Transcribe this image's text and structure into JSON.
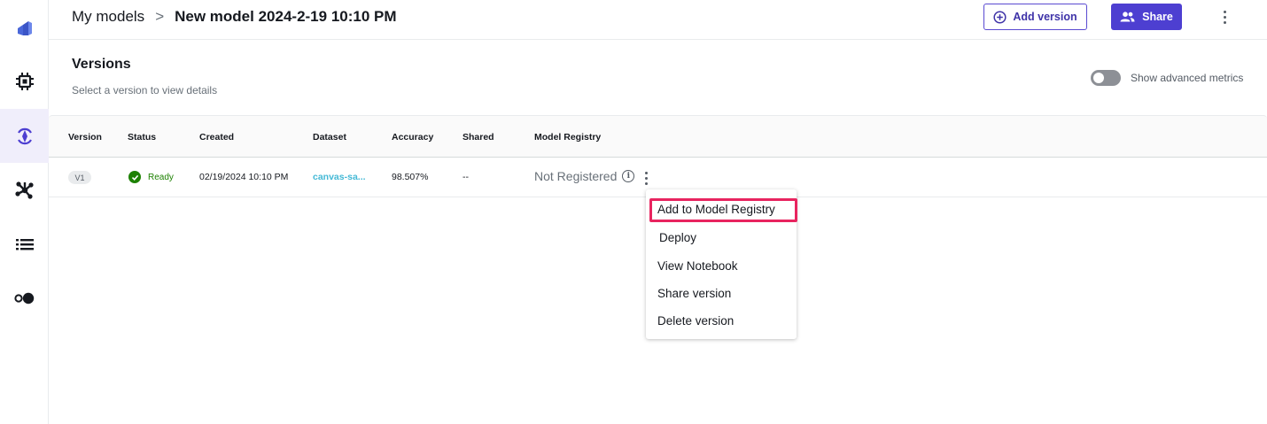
{
  "breadcrumb": {
    "parent": "My models",
    "separator": ">",
    "current": "New model 2024-2-19 10:10 PM"
  },
  "header": {
    "add_version_label": "Add version",
    "share_label": "Share"
  },
  "versions": {
    "title": "Versions",
    "subtitle": "Select a version to view details",
    "advanced_metrics_label": "Show advanced metrics",
    "advanced_metrics_on": false
  },
  "table": {
    "columns": [
      "Version",
      "Status",
      "Created",
      "Dataset",
      "Accuracy",
      "Shared",
      "Model Registry"
    ],
    "rows": [
      {
        "version": "V1",
        "status": "Ready",
        "created": "02/19/2024 10:10 PM",
        "dataset": "canvas-sa...",
        "accuracy": "98.507%",
        "shared": "--",
        "registry": "Not Registered"
      }
    ]
  },
  "menu": {
    "items": [
      "Add to Model Registry",
      "Deploy",
      "View Notebook",
      "Share version",
      "Delete version"
    ],
    "highlighted": "Add to Model Registry"
  },
  "colors": {
    "accent": "#4d3fd1",
    "ready": "#1d8102",
    "highlight": "#e8245f",
    "link": "#44b9d6"
  },
  "icons": [
    "canvas-logo-icon",
    "chip-icon",
    "models-icon",
    "nodes-icon",
    "list-icon",
    "toggle-dots-icon",
    "plus-circle-icon",
    "users-icon",
    "kebab-icon",
    "check-icon",
    "info-icon"
  ]
}
